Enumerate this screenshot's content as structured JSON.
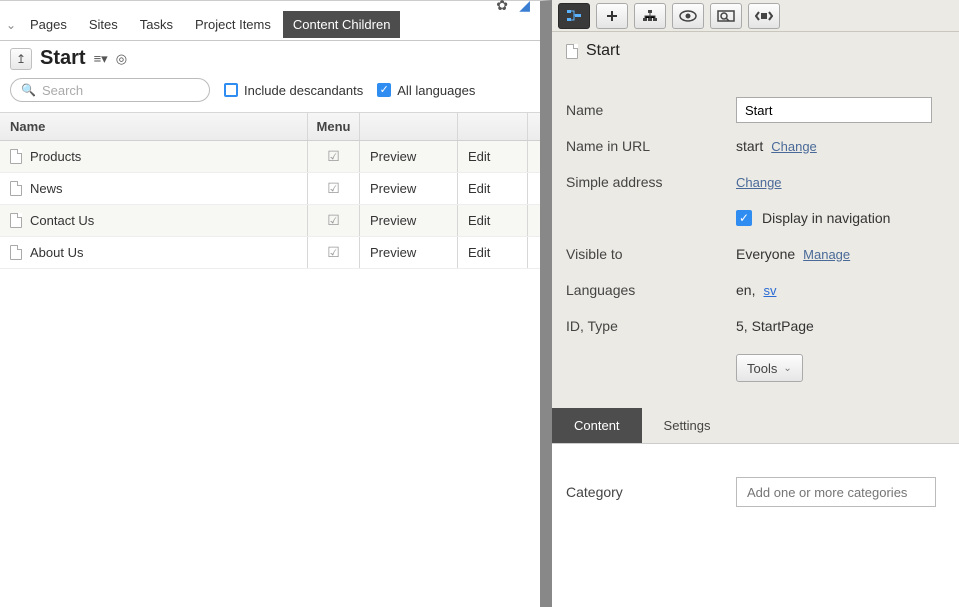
{
  "leftTabs": {
    "pages": "Pages",
    "sites": "Sites",
    "tasks": "Tasks",
    "projectItems": "Project Items",
    "contentChildren": "Content Children"
  },
  "titleRow": {
    "title": "Start"
  },
  "search": {
    "placeholder": "Search",
    "includeDescendants": "Include descandants",
    "allLanguages": "All languages"
  },
  "table": {
    "headers": {
      "name": "Name",
      "menu": "Menu"
    },
    "preview": "Preview",
    "edit": "Edit",
    "rows": [
      {
        "name": "Products"
      },
      {
        "name": "News"
      },
      {
        "name": "Contact Us"
      },
      {
        "name": "About Us"
      }
    ]
  },
  "right": {
    "title": "Start",
    "labels": {
      "name": "Name",
      "nameInUrl": "Name in URL",
      "simpleAddress": "Simple address",
      "displayInNav": "Display in navigation",
      "visibleTo": "Visible to",
      "languages": "Languages",
      "idType": "ID, Type",
      "category": "Category"
    },
    "values": {
      "nameField": "Start",
      "nameInUrl": "start",
      "change": "Change",
      "visibleTo": "Everyone",
      "manage": "Manage",
      "langEn": "en,",
      "langSv": "sv",
      "idType": "5, StartPage",
      "tools": "Tools",
      "categoryPlaceholder": "Add one or more categories"
    },
    "tabs": {
      "content": "Content",
      "settings": "Settings"
    }
  }
}
